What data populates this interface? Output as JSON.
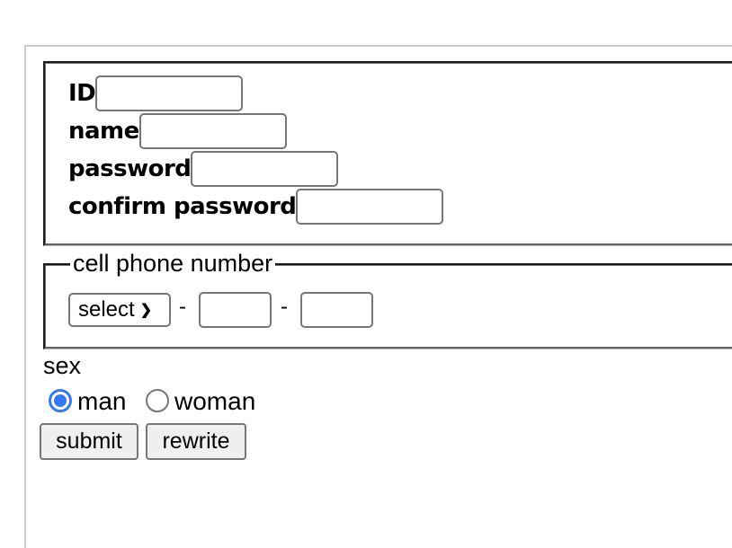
{
  "account": {
    "fields": [
      {
        "label": "ID",
        "value": "",
        "type": "text"
      },
      {
        "label": "name",
        "value": "",
        "type": "text"
      },
      {
        "label": "password",
        "value": "",
        "type": "password"
      },
      {
        "label": "confirm password",
        "value": "",
        "type": "password"
      }
    ]
  },
  "phone": {
    "legend": "cell phone number",
    "select_value": "select",
    "separator": "-",
    "middle_value": "",
    "last_value": ""
  },
  "sex": {
    "label": "sex",
    "options": [
      {
        "label": "man",
        "checked": true
      },
      {
        "label": "woman",
        "checked": false
      }
    ],
    "accent_color": "#3478f6"
  },
  "buttons": {
    "submit_label": "submit",
    "rewrite_label": "rewrite"
  }
}
